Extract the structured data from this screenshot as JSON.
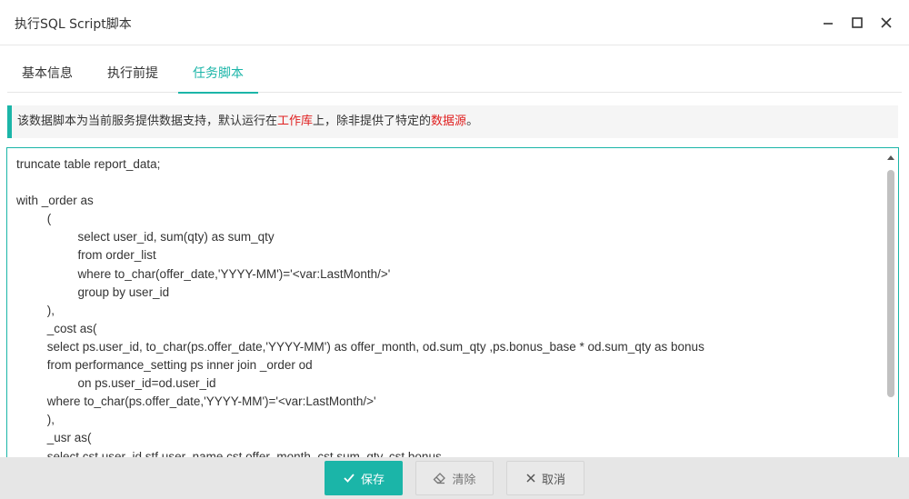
{
  "window": {
    "title": "执行SQL Script脚本"
  },
  "tabs": [
    {
      "label": "基本信息",
      "active": false
    },
    {
      "label": "执行前提",
      "active": false
    },
    {
      "label": "任务脚本",
      "active": true
    }
  ],
  "notice": {
    "part1": "该数据脚本为当前服务提供数据支持，默认运行在",
    "highlight1": "工作库",
    "part2": "上，除非提供了特定的",
    "highlight2": "数据源",
    "part3": "。"
  },
  "editor": {
    "code": "truncate table report_data;\n\nwith _order as\n         (\n                  select user_id, sum(qty) as sum_qty\n                  from order_list\n                  where to_char(offer_date,'YYYY-MM')='<var:LastMonth/>'\n                  group by user_id\n         ),\n         _cost as(\n         select ps.user_id, to_char(ps.offer_date,'YYYY-MM') as offer_month, od.sum_qty ,ps.bonus_base * od.sum_qty as bonus\n         from performance_setting ps inner join _order od\n                  on ps.user_id=od.user_id\n         where to_char(ps.offer_date,'YYYY-MM')='<var:LastMonth/>'\n         ),\n         _usr as(\n         select cst.user_id,stf.user_name,cst.offer_month, cst.sum_qty, cst.bonus"
  },
  "footer": {
    "save_label": "保存",
    "clear_label": "清除",
    "cancel_label": "取消"
  },
  "colors": {
    "accent": "#1bb5a8",
    "highlight": "#e02020"
  }
}
